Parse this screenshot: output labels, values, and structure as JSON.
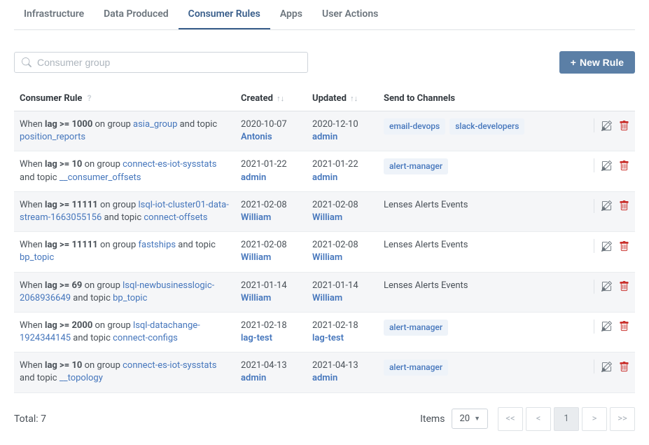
{
  "tabs": [
    {
      "label": "Infrastructure",
      "active": false
    },
    {
      "label": "Data Produced",
      "active": false
    },
    {
      "label": "Consumer Rules",
      "active": true
    },
    {
      "label": "Apps",
      "active": false
    },
    {
      "label": "User Actions",
      "active": false
    }
  ],
  "search": {
    "placeholder": "Consumer group"
  },
  "new_rule_btn": "New Rule",
  "columns": {
    "rule": "Consumer Rule",
    "created": "Created",
    "updated": "Updated",
    "channels": "Send to Channels"
  },
  "rows": [
    {
      "prefix": "When ",
      "cond": "lag >= 1000",
      "middle1": " on group ",
      "group": "asia_group",
      "middle2": " and topic ",
      "topic": "position_reports",
      "created_date": "2020-10-07",
      "created_user": "Antonis",
      "updated_date": "2020-12-10",
      "updated_user": "admin",
      "channels_type": "pill",
      "channels": [
        "email-devops",
        "slack-developers"
      ]
    },
    {
      "prefix": "When ",
      "cond": "lag >= 10",
      "middle1": " on group ",
      "group": "connect-es-iot-sysstats",
      "middle2": " and topic ",
      "topic": "__consumer_offsets",
      "created_date": "2021-01-22",
      "created_user": "admin",
      "updated_date": "2021-01-22",
      "updated_user": "admin",
      "channels_type": "pill",
      "channels": [
        "alert-manager"
      ]
    },
    {
      "prefix": "When ",
      "cond": "lag >= 11111",
      "middle1": " on group ",
      "group": "lsql-iot-cluster01-data-stream-1663055156",
      "middle2": " and topic ",
      "topic": "connect-offsets",
      "created_date": "2021-02-08",
      "created_user": "William",
      "updated_date": "2021-02-08",
      "updated_user": "William",
      "channels_type": "plain",
      "channels_plain": "Lenses Alerts Events"
    },
    {
      "prefix": "When ",
      "cond": "lag >= 11111",
      "middle1": " on group ",
      "group": "fastships",
      "middle2": " and topic ",
      "topic": "bp_topic",
      "created_date": "2021-02-08",
      "created_user": "William",
      "updated_date": "2021-02-08",
      "updated_user": "William",
      "channels_type": "plain",
      "channels_plain": "Lenses Alerts Events"
    },
    {
      "prefix": "When ",
      "cond": "lag >= 69",
      "middle1": " on group ",
      "group": "lsql-newbusinesslogic-2068936649",
      "middle2": " and topic ",
      "topic": "bp_topic",
      "created_date": "2021-01-14",
      "created_user": "William",
      "updated_date": "2021-01-14",
      "updated_user": "William",
      "channels_type": "plain",
      "channels_plain": "Lenses Alerts Events"
    },
    {
      "prefix": "When ",
      "cond": "lag >= 2000",
      "middle1": " on group ",
      "group": "lsql-datachange-1924344145",
      "middle2": " and topic ",
      "topic": "connect-configs",
      "created_date": "2021-02-18",
      "created_user": "lag-test",
      "updated_date": "2021-02-18",
      "updated_user": "lag-test",
      "channels_type": "pill",
      "channels": [
        "alert-manager"
      ]
    },
    {
      "prefix": "When ",
      "cond": "lag >= 10",
      "middle1": " on group ",
      "group": "connect-es-iot-sysstats",
      "middle2": " and topic ",
      "topic": "__topology",
      "created_date": "2021-04-13",
      "created_user": "admin",
      "updated_date": "2021-04-13",
      "updated_user": "admin",
      "channels_type": "pill",
      "channels": [
        "alert-manager"
      ]
    }
  ],
  "footer": {
    "total_label": "Total: ",
    "total_value": "7",
    "items_label": "Items",
    "per_page": "20",
    "first": "<<",
    "prev": "<",
    "current": "1",
    "next": ">",
    "last": ">>"
  }
}
